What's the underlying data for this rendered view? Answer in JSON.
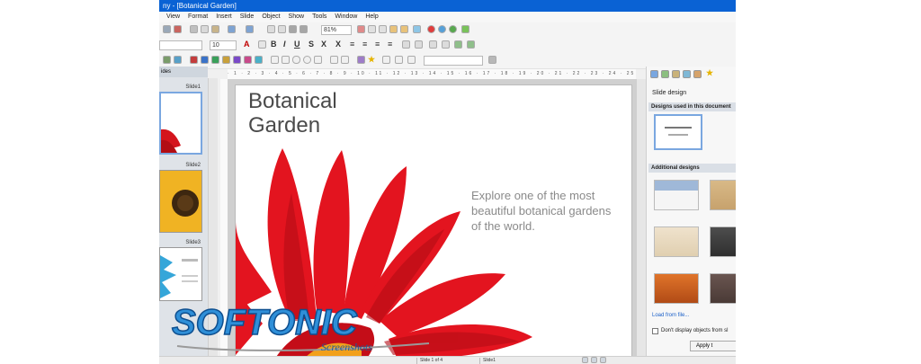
{
  "window": {
    "title": "ny - [Botanical Garden]"
  },
  "menu": [
    "View",
    "Format",
    "Insert",
    "Slide",
    "Object",
    "Show",
    "Tools",
    "Window",
    "Help"
  ],
  "toolbar": {
    "zoom": "81%",
    "font_size": "10"
  },
  "sidebar": {
    "tab_label": "ides",
    "slides": [
      {
        "label": "Slide1"
      },
      {
        "label": "Slide2"
      },
      {
        "label": "Slide3"
      }
    ]
  },
  "slide": {
    "title_line1": "Botanical",
    "title_line2": "Garden",
    "body": "Explore one of the most beautiful botanical gardens of the world."
  },
  "ruler": {
    "marks": "· 1 · 2 · 3 · 4 · 5 · 6 · 7 · 8 · 9 · 10 · 11 · 12 · 13 · 14 · 15 · 16 · 17 · 18 · 19 · 20 · 21 · 22 · 23 · 24 · 25 ·"
  },
  "panel": {
    "title": "Slide design",
    "used_heading": "Designs used in this document",
    "additional_heading": "Additional designs",
    "load_link": "Load from file...",
    "dont_display": "Don't display objects from sl",
    "apply_button": "Apply t"
  },
  "status": {
    "slide_of": "Slide 1 of 4",
    "slide_name": "Slide1"
  },
  "watermark": {
    "brand": "SOFTONIC",
    "sub": "Screenshots"
  },
  "colors": {
    "titlebar": "#0a62d4",
    "flower": "#e3141f"
  }
}
